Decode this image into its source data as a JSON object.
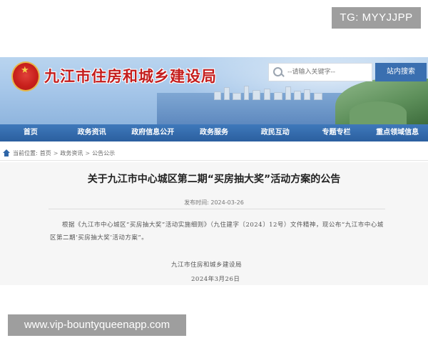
{
  "overlay": {
    "tg_label": "TG: MYYJJPP",
    "url_label": "www.vip-bountyqueenapp.com"
  },
  "header": {
    "site_title": "九江市住房和城乡建设局",
    "search_placeholder": "--请输入关键字--",
    "search_button": "站内搜索"
  },
  "nav": {
    "items": [
      "首页",
      "政务资讯",
      "政府信息公开",
      "政务服务",
      "政民互动",
      "专题专栏",
      "重点领域信息"
    ]
  },
  "breadcrumb": {
    "label": "当前位置:",
    "items": [
      "首页",
      "政务资讯",
      "公告公示"
    ],
    "separator": ">"
  },
  "article": {
    "title": "关于九江市中心城区第二期“买房抽大奖”活动方案的公告",
    "published": "发布时间: 2024-03-26",
    "body": "根据《九江市中心城区“买房抽大奖”活动实施细则》（九住建字〔2024〕12号）文件精神，现公布“九江市中心城区第二期‘买房抽大奖’活动方案”。",
    "signature_org": "九江市住房和城乡建设局",
    "signature_date": "2024年3月26日"
  },
  "colors": {
    "nav_blue": "#2f66a8",
    "title_red": "#c41d1d",
    "overlay_gray": "#9e9e9e"
  }
}
